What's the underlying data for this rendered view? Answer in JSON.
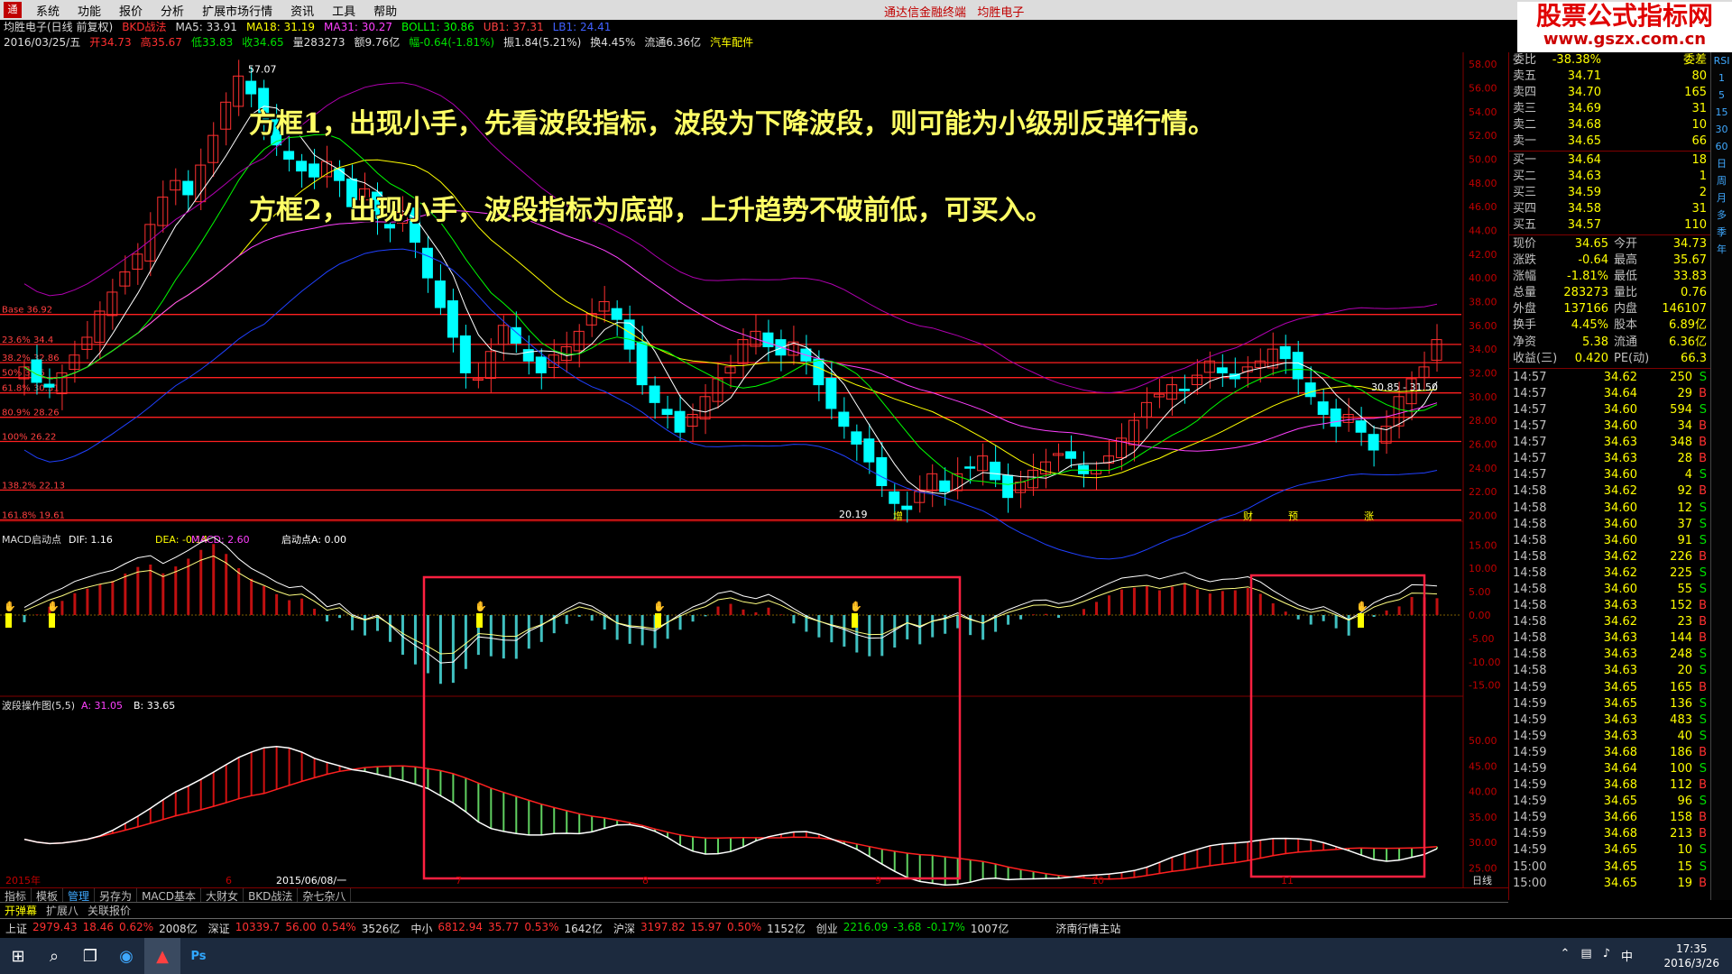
{
  "menu": {
    "items": [
      "系统",
      "功能",
      "报价",
      "分析",
      "扩展市场行情",
      "资讯",
      "工具",
      "帮助"
    ],
    "center": "通达信金融终端",
    "center2": "均胜电子"
  },
  "watermark": {
    "line1": "股票公式指标网",
    "line2": "www.gszx.com.cn"
  },
  "info": {
    "row1": [
      "均胜电子(日线 前复权)",
      "BKD战法",
      "MA5: 33.91",
      "MA18: 31.19",
      "MA31: 30.27",
      "BOLL1: 30.86",
      "UB1: 37.31",
      "LB1: 24.41"
    ],
    "row2": [
      "2016/03/25/五",
      "开34.73",
      "高35.67",
      "低33.83",
      "收34.65",
      "量283273",
      "额9.76亿",
      "幅-0.64(-1.81%)",
      "振1.84(5.21%)",
      "换4.45%",
      "流通6.36亿",
      "汽车配件"
    ]
  },
  "overlay": {
    "line1": "方框1，出现小手，先看波段指标，波段为下降波段，则可能为小级别反弹行情。",
    "line2": "方框2，出现小手，波段指标为底部，上升趋势不破前低，可买入。"
  },
  "chart_data": [
    {
      "type": "candlestick",
      "title": "均胜电子(日线 前复权)",
      "yticks": [
        20,
        22,
        24,
        26,
        28,
        30,
        32,
        34,
        36,
        38,
        40,
        42,
        44,
        46,
        48,
        50,
        52,
        54,
        56,
        58
      ],
      "ylim": [
        19.5,
        59
      ],
      "fib_levels": [
        {
          "label": "Base 36.92",
          "value": 36.92
        },
        {
          "label": "23.6% 34.4",
          "value": 34.4
        },
        {
          "label": "38.2% 32.86",
          "value": 32.86
        },
        {
          "label": "50% 31.6",
          "value": 31.6
        },
        {
          "label": "61.8% 30.31",
          "value": 30.31
        },
        {
          "label": "80.9% 28.26",
          "value": 28.26
        },
        {
          "label": "100% 26.22",
          "value": 26.22
        },
        {
          "label": "138.2% 22.13",
          "value": 22.13
        },
        {
          "label": "161.8% 19.61",
          "value": 19.61
        }
      ],
      "annotations": [
        "57.07",
        "20.19",
        "30.85 - 31.50"
      ],
      "markers": [
        "增",
        "财",
        "预",
        "涨"
      ],
      "close": [
        32.5,
        31.2,
        30.8,
        32.0,
        33.5,
        35.0,
        37.2,
        38.8,
        40.5,
        42.0,
        44.5,
        46.8,
        48.2,
        47.0,
        49.5,
        52.0,
        54.8,
        57.0,
        55.5,
        53.0,
        51.2,
        50.0,
        49.0,
        48.5,
        49.8,
        48.2,
        46.0,
        47.5,
        45.0,
        44.2,
        45.5,
        43.0,
        40.0,
        37.5,
        35.0,
        32.0,
        31.5,
        33.8,
        36.0,
        34.5,
        33.0,
        32.0,
        33.5,
        34.2,
        35.5,
        37.0,
        38.0,
        36.5,
        34.0,
        31.0,
        29.5,
        28.5,
        27.0,
        28.5,
        30.0,
        31.5,
        32.5,
        34.8,
        35.5,
        34.2,
        33.5,
        34.6,
        33.0,
        31.0,
        29.0,
        27.5,
        26.0,
        24.5,
        22.5,
        21.0,
        20.5,
        22.0,
        23.5,
        22.0,
        23.5,
        24.0,
        25.0,
        23.0,
        21.5,
        22.8,
        23.8,
        24.5,
        25.2,
        24.8,
        23.5,
        23.8,
        25.0,
        26.5,
        28.0,
        29.5,
        30.2,
        31.0,
        30.5,
        31.8,
        33.0,
        32.0,
        31.5,
        32.5,
        33.0,
        34.0,
        33.2,
        31.5,
        30.0,
        28.5,
        27.5,
        28.5,
        27.0,
        25.5,
        27.5,
        30.0,
        31.5,
        32.5,
        34.8
      ]
    },
    {
      "type": "macd",
      "title": "MACD启动点",
      "legend": [
        "DIF: 1.16",
        "DEA: -0.14",
        "MACD: 2.60",
        "启动点A: 0.00"
      ],
      "yticks": [
        -15,
        -10,
        -5,
        0,
        5,
        10,
        15
      ],
      "ylim": [
        -17,
        17
      ]
    },
    {
      "type": "wave",
      "title": "波段操作图(5,5)",
      "legend": [
        "A: 31.05",
        "B: 33.65"
      ],
      "yticks": [
        25,
        30,
        35,
        40,
        45,
        50
      ],
      "ylim": [
        24,
        58
      ]
    }
  ],
  "xaxis": {
    "labels": [
      "2015年",
      "6",
      "2015/06/08/一",
      "7",
      "8",
      "9",
      "10",
      "11"
    ],
    "tail": "日线"
  },
  "right": {
    "sell": [
      {
        "l": "委比",
        "p": "-38.38%",
        "v": "委差"
      },
      {
        "l": "卖五",
        "p": "34.71",
        "v": "80"
      },
      {
        "l": "卖四",
        "p": "34.70",
        "v": "165"
      },
      {
        "l": "卖三",
        "p": "34.69",
        "v": "31"
      },
      {
        "l": "卖二",
        "p": "34.68",
        "v": "10"
      },
      {
        "l": "卖一",
        "p": "34.65",
        "v": "66"
      }
    ],
    "buy": [
      {
        "l": "买一",
        "p": "34.64",
        "v": "18"
      },
      {
        "l": "买二",
        "p": "34.63",
        "v": "1"
      },
      {
        "l": "买三",
        "p": "34.59",
        "v": "2"
      },
      {
        "l": "买四",
        "p": "34.58",
        "v": "31"
      },
      {
        "l": "买五",
        "p": "34.57",
        "v": "110"
      }
    ],
    "quote": [
      {
        "a": "现价",
        "b": "34.65",
        "c": "今开",
        "d": "34.73"
      },
      {
        "a": "涨跌",
        "b": "-0.64",
        "c": "最高",
        "d": "35.67"
      },
      {
        "a": "涨幅",
        "b": "-1.81%",
        "c": "最低",
        "d": "33.83"
      },
      {
        "a": "总量",
        "b": "283273",
        "c": "量比",
        "d": "0.76"
      },
      {
        "a": "外盘",
        "b": "137166",
        "c": "内盘",
        "d": "146107"
      },
      {
        "a": "换手",
        "b": "4.45%",
        "c": "股本",
        "d": "6.89亿"
      },
      {
        "a": "净资",
        "b": "5.38",
        "c": "流通",
        "d": "6.36亿"
      },
      {
        "a": "收益(三)",
        "b": "0.420",
        "c": "PE(动)",
        "d": "66.3"
      }
    ],
    "ticks": [
      {
        "t": "14:57",
        "p": "34.62",
        "v": "250",
        "s": "S"
      },
      {
        "t": "14:57",
        "p": "34.64",
        "v": "29",
        "s": "B"
      },
      {
        "t": "14:57",
        "p": "34.60",
        "v": "594",
        "s": "S"
      },
      {
        "t": "14:57",
        "p": "34.60",
        "v": "34",
        "s": "B"
      },
      {
        "t": "14:57",
        "p": "34.63",
        "v": "348",
        "s": "B"
      },
      {
        "t": "14:57",
        "p": "34.63",
        "v": "28",
        "s": "B"
      },
      {
        "t": "14:57",
        "p": "34.60",
        "v": "4",
        "s": "S"
      },
      {
        "t": "14:58",
        "p": "34.62",
        "v": "92",
        "s": "B"
      },
      {
        "t": "14:58",
        "p": "34.60",
        "v": "12",
        "s": "S"
      },
      {
        "t": "14:58",
        "p": "34.60",
        "v": "37",
        "s": "S"
      },
      {
        "t": "14:58",
        "p": "34.60",
        "v": "91",
        "s": "S"
      },
      {
        "t": "14:58",
        "p": "34.62",
        "v": "226",
        "s": "B"
      },
      {
        "t": "14:58",
        "p": "34.62",
        "v": "225",
        "s": "S"
      },
      {
        "t": "14:58",
        "p": "34.60",
        "v": "55",
        "s": "S"
      },
      {
        "t": "14:58",
        "p": "34.63",
        "v": "152",
        "s": "B"
      },
      {
        "t": "14:58",
        "p": "34.62",
        "v": "23",
        "s": "B"
      },
      {
        "t": "14:58",
        "p": "34.63",
        "v": "144",
        "s": "B"
      },
      {
        "t": "14:58",
        "p": "34.63",
        "v": "248",
        "s": "S"
      },
      {
        "t": "14:58",
        "p": "34.63",
        "v": "20",
        "s": "S"
      },
      {
        "t": "14:59",
        "p": "34.65",
        "v": "165",
        "s": "B"
      },
      {
        "t": "14:59",
        "p": "34.65",
        "v": "136",
        "s": "S"
      },
      {
        "t": "14:59",
        "p": "34.63",
        "v": "483",
        "s": "S"
      },
      {
        "t": "14:59",
        "p": "34.63",
        "v": "40",
        "s": "S"
      },
      {
        "t": "14:59",
        "p": "34.68",
        "v": "186",
        "s": "B"
      },
      {
        "t": "14:59",
        "p": "34.64",
        "v": "100",
        "s": "S"
      },
      {
        "t": "14:59",
        "p": "34.68",
        "v": "112",
        "s": "B"
      },
      {
        "t": "14:59",
        "p": "34.65",
        "v": "96",
        "s": "S"
      },
      {
        "t": "14:59",
        "p": "34.66",
        "v": "158",
        "s": "B"
      },
      {
        "t": "14:59",
        "p": "34.68",
        "v": "213",
        "s": "B"
      },
      {
        "t": "14:59",
        "p": "34.65",
        "v": "10",
        "s": "S"
      },
      {
        "t": "15:00",
        "p": "34.65",
        "v": "15",
        "s": "S"
      },
      {
        "t": "15:00",
        "p": "34.65",
        "v": "19",
        "s": "B"
      }
    ],
    "bottomtabs": [
      "笔",
      "价",
      "细",
      "日",
      "势",
      "联",
      "值",
      "筹"
    ]
  },
  "sideicons": [
    "RSI",
    "1",
    "5",
    "15",
    "30",
    "60",
    "日",
    "周",
    "月",
    "多",
    "季",
    "年"
  ],
  "bottomtabs": {
    "row1": [
      "指标",
      "模板",
      "管理",
      "另存为",
      "MACD基本",
      "大财女",
      "BKD战法",
      "杂七杂八"
    ],
    "row2": [
      "开弹幕",
      "扩展八",
      "关联报价"
    ]
  },
  "indexbar": [
    {
      "n": "上证",
      "v": "2979.43",
      "c": "18.46",
      "p": "0.62%",
      "a": "2008亿",
      "dir": "up"
    },
    {
      "n": "深证",
      "v": "10339.7",
      "c": "56.00",
      "p": "0.54%",
      "a": "3526亿",
      "dir": "up"
    },
    {
      "n": "中小",
      "v": "6812.94",
      "c": "35.77",
      "p": "0.53%",
      "a": "1642亿",
      "dir": "up"
    },
    {
      "n": "沪深",
      "v": "3197.82",
      "c": "15.97",
      "p": "0.50%",
      "a": "1152亿",
      "dir": "up"
    },
    {
      "n": "创业",
      "v": "2216.09",
      "c": "-3.68",
      "p": "-0.17%",
      "a": "1007亿",
      "dir": "dn"
    }
  ],
  "station": "济南行情主站",
  "taskbar": {
    "time": "17:35",
    "date": "2016/3/26",
    "tray": "中"
  }
}
